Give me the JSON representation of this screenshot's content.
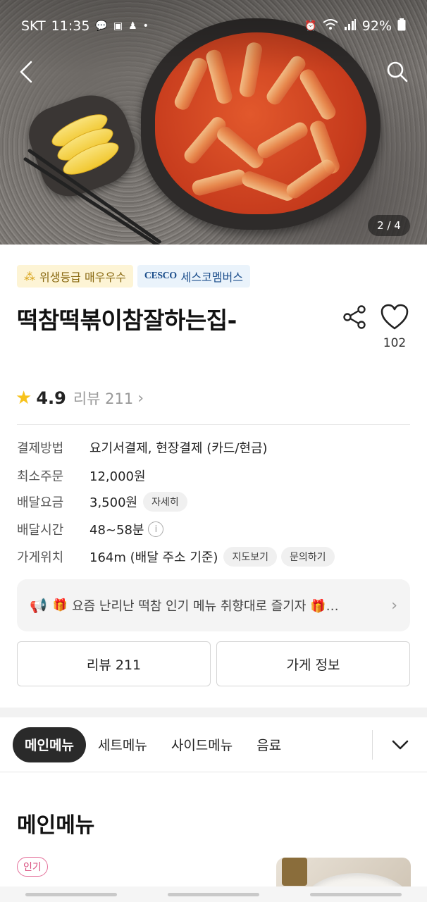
{
  "status_bar": {
    "carrier": "SKT",
    "time": "11:35",
    "battery": "92%",
    "icons": [
      "talk-icon",
      "fifa-icon",
      "notification-icon",
      "dot-icon",
      "alarm-icon",
      "wifi-icon",
      "signal-icon",
      "battery-icon"
    ]
  },
  "hero": {
    "page_counter": "2 / 4",
    "current_page": 2,
    "total_pages": 4
  },
  "badges": {
    "hygiene": "위생등급 매우우수",
    "cesco_logo": "CESCO",
    "cesco": "세스코멤버스"
  },
  "store": {
    "name": "떡참떡볶이참잘하는집-",
    "like_count": "102",
    "rating": "4.9",
    "review_label": "리뷰 211"
  },
  "info": {
    "payment_label": "결제방법",
    "payment_value": "요기서결제, 현장결제 (카드/현금)",
    "min_order_label": "최소주문",
    "min_order_value": "12,000원",
    "delivery_fee_label": "배달요금",
    "delivery_fee_value": "3,500원",
    "delivery_fee_detail": "자세히",
    "delivery_time_label": "배달시간",
    "delivery_time_value": "48~58분",
    "delivery_time_info": "i",
    "location_label": "가게위치",
    "location_value": "164m (배달 주소 기준)",
    "map_button": "지도보기",
    "inquiry_button": "문의하기"
  },
  "notice": {
    "text": "요즘 난리난 떡참 인기 메뉴 취향대로 즐기자 🎁…"
  },
  "buttons": {
    "reviews": "리뷰 211",
    "store_info": "가게 정보"
  },
  "tabs": [
    {
      "label": "메인메뉴",
      "active": true
    },
    {
      "label": "세트메뉴",
      "active": false
    },
    {
      "label": "사이드메뉴",
      "active": false
    },
    {
      "label": "음료",
      "active": false
    }
  ],
  "menu_section": {
    "title": "메인메뉴",
    "popular_tag": "인기"
  },
  "colors": {
    "accent_dark": "#2a2a2a",
    "star": "#f7c21b",
    "popular_pink": "#d9507f"
  }
}
